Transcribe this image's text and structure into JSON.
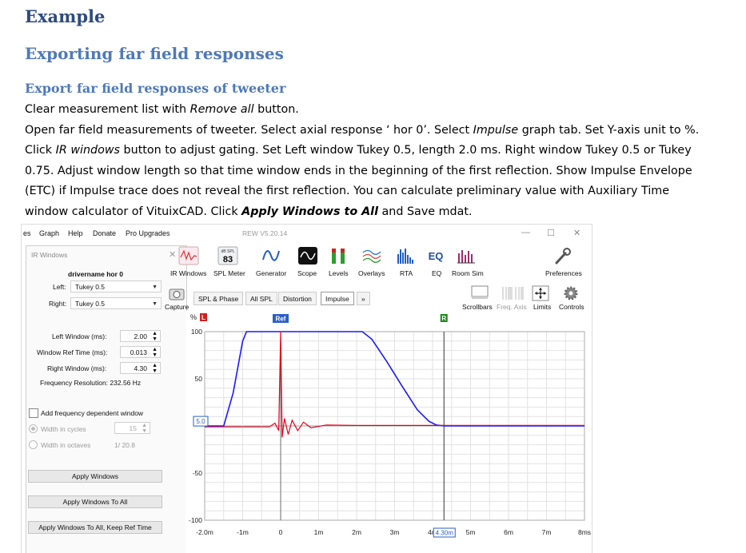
{
  "doc": {
    "heading1": "Example",
    "heading2": "Exporting far field responses",
    "heading3": "Export far field responses of tweeter",
    "line1": [
      "Clear measurement list with ",
      "Remove all",
      " button."
    ],
    "line2": [
      "Open far field measurements of tweeter. Select axial response ‘ hor 0’. Select ",
      "Impulse",
      " graph tab. Set Y-axis unit to %."
    ],
    "line3": [
      "Click ",
      "IR windows",
      " button to adjust gating. Set Left window Tukey 0.5, length 2.0 ms. Right window Tukey 0.5 or Tukey"
    ],
    "line4": "0.75. Adjust window length so that time window ends in the beginning of the first reflection. Show Impulse Envelope",
    "line5": "(ETC) if Impulse trace does not reveal the first reflection. You can calculate preliminary value with Auxiliary Time",
    "line6": [
      "window calculator of VituixCAD. Click ",
      "Apply Windows to All",
      " and Save mdat."
    ]
  },
  "app": {
    "menu": [
      "es",
      "Graph",
      "Help",
      "Donate",
      "Pro Upgrades"
    ],
    "title": "REW V5.20.14",
    "win_controls": [
      "—",
      "☐",
      "✕"
    ]
  },
  "ir_panel": {
    "title": "IR Windows",
    "close": "✕",
    "measurement": "drivername hor 0",
    "left_label": "Left:",
    "left_value": "Tukey 0.5",
    "right_label": "Right:",
    "right_value": "Tukey 0.5",
    "left_window_label": "Left Window (ms):",
    "left_window_value": "2.00",
    "ref_time_label": "Window Ref Time (ms):",
    "ref_time_value": "0.013",
    "right_window_label": "Right Window (ms):",
    "right_window_value": "4.30",
    "freq_res": "Frequency Resolution: 232.56 Hz",
    "add_freq_dep": "Add frequency dependent window",
    "width_cycles_label": "Width in cycles",
    "width_cycles_value": "15",
    "width_octaves_label": "Width in octaves",
    "width_octaves_value": "1/ 20.8",
    "btn_apply": "Apply Windows",
    "btn_apply_all": "Apply Windows To All",
    "btn_apply_all_keep": "Apply Windows To All, Keep Ref Time"
  },
  "toolbar": {
    "items": [
      {
        "label": "IR Windows",
        "icon": "ir-windows-icon"
      },
      {
        "label": "SPL Meter",
        "icon": "spl-meter-icon",
        "spl_unit": "dB SPL",
        "spl_value": "83"
      },
      {
        "label": "Generator",
        "icon": "generator-icon"
      },
      {
        "label": "Scope",
        "icon": "scope-icon"
      },
      {
        "label": "Levels",
        "icon": "levels-icon"
      },
      {
        "label": "Overlays",
        "icon": "overlays-icon"
      },
      {
        "label": "RTA",
        "icon": "rta-icon"
      },
      {
        "label": "EQ",
        "icon": "eq-icon"
      },
      {
        "label": "Room Sim",
        "icon": "room-sim-icon"
      },
      {
        "label": "Preferences",
        "icon": "wrench-icon"
      }
    ],
    "capture": "Capture",
    "scrollbars": "Scrollbars",
    "freq_axis": "Freq. Axis",
    "limits": "Limits",
    "controls": "Controls"
  },
  "tabs": [
    "SPL & Phase",
    "All SPL",
    "Distortion",
    "Impulse",
    "»"
  ],
  "active_tab": "Impulse",
  "colors": {
    "window_curve": "#1a1aff",
    "impulse": "#e8001c",
    "ref_marker": "#2a5fc7",
    "left_marker": "#d21f1f",
    "right_marker": "#1b8a1b"
  },
  "chart_data": {
    "type": "line",
    "y_unit": "%",
    "xlim": [
      -2.0,
      8.0
    ],
    "ylim": [
      -100,
      100
    ],
    "x_ticks": [
      "-2.0m",
      "-1m",
      "0",
      "1m",
      "2m",
      "3m",
      "4m",
      "5m",
      "6m",
      "7m",
      "8ms"
    ],
    "x_tick_values": [
      -2,
      -1,
      0,
      1,
      2,
      3,
      4,
      5,
      6,
      7,
      8
    ],
    "y_ticks": [
      "100",
      "50",
      "-50",
      "-100"
    ],
    "y_tick_values": [
      100,
      50,
      -50,
      -100
    ],
    "grid": true,
    "markers": {
      "left": "L",
      "ref": "Ref",
      "right": "R",
      "ref_x": 0,
      "right_x": 4.3
    },
    "y_readout": "5.0",
    "x_readout": "4.30m",
    "series": [
      {
        "name": "",
        "style": "window",
        "x": [
          -2.0,
          -1.5,
          -1.25,
          -1.0,
          -0.9,
          0.0,
          1.0,
          2.0,
          2.15,
          2.4,
          2.8,
          3.2,
          3.6,
          3.9,
          4.1,
          4.3,
          8.0
        ],
        "y": [
          0,
          0,
          35,
          90,
          100,
          100,
          100,
          100,
          100,
          92,
          68,
          42,
          17,
          5,
          1,
          0,
          0
        ]
      },
      {
        "name": "",
        "style": "impulse",
        "x": [
          -2.0,
          -1.0,
          -0.3,
          -0.15,
          -0.05,
          0.0,
          0.04,
          0.1,
          0.2,
          0.3,
          0.45,
          0.6,
          0.8,
          1.2,
          2.0,
          4.3,
          8.0
        ],
        "y": [
          -1,
          -1,
          -1,
          3,
          -5,
          100,
          -12,
          8,
          -9,
          6,
          -5,
          4,
          -2,
          1,
          0.5,
          0.5,
          0.5
        ]
      }
    ]
  }
}
